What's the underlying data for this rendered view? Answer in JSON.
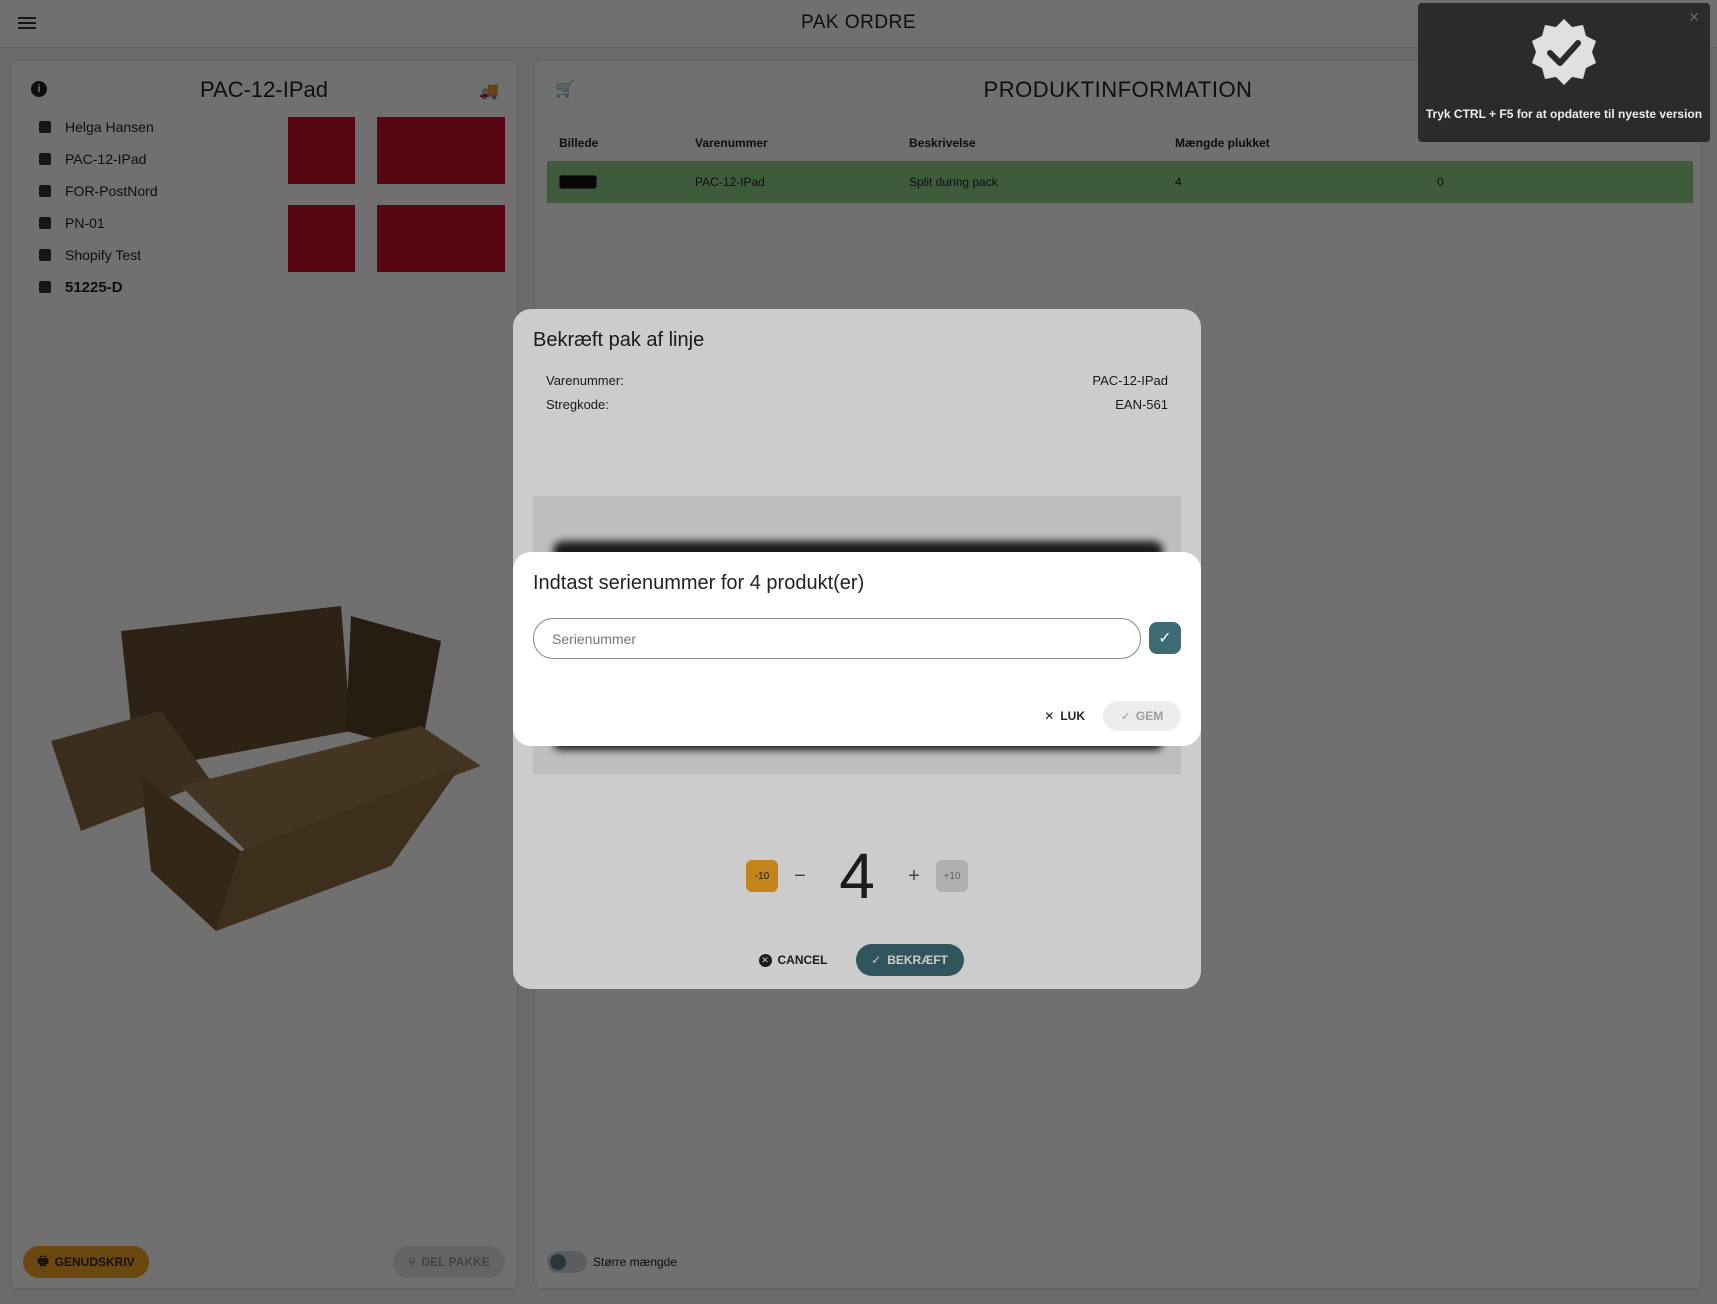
{
  "topbar": {
    "title": "PAK ORDRE"
  },
  "left_panel": {
    "title": "PAC-12-IPad",
    "info": [
      {
        "icon": "person-icon",
        "text": "Helga Hansen"
      },
      {
        "icon": "box-up-icon",
        "text": "PAC-12-IPad"
      },
      {
        "icon": "truck-icon",
        "text": "FOR-PostNord"
      },
      {
        "icon": "truck-icon",
        "text": "PN-01"
      },
      {
        "icon": "store-icon",
        "text": "Shopify Test"
      },
      {
        "icon": "save-icon",
        "text": "51225-D"
      }
    ],
    "genudskriv_label": "GENUDSKRIV",
    "delpakke_label": "DEL PAKKE"
  },
  "right_panel": {
    "title": "PRODUKTINFORMATION",
    "table": {
      "headers": [
        "Billede",
        "Varenummer",
        "Beskrivelse",
        "Mængde plukket",
        ""
      ],
      "rows": [
        {
          "varenummer": "PAC-12-IPad",
          "beskrivelse": "Split during pack",
          "plukket": "4",
          "extra": "0"
        }
      ]
    },
    "toggle_label": "Større mængde"
  },
  "confirm_dialog": {
    "title": "Bekræft pak af linje",
    "varenummer_label": "Varenummer:",
    "varenummer_value": "PAC-12-IPad",
    "stregkode_label": "Stregkode:",
    "stregkode_value": "EAN-561",
    "minus10": "-10",
    "minus": "−",
    "quantity": "4",
    "plus": "+",
    "plus10": "+10",
    "cancel_label": "CANCEL",
    "confirm_label": "BEKRÆFT"
  },
  "serial_dialog": {
    "title": "Indtast serienummer for 4 produkt(er)",
    "placeholder": "Serienummer",
    "close_label": "LUK",
    "save_label": "GEM"
  },
  "toast": {
    "message": "Tryk CTRL + F5 for at opdatere til nyeste version"
  },
  "colors": {
    "accent": "#3e6b73",
    "warning": "#f5a623",
    "row_highlight": "#8fd18a",
    "flag_red": "#c8102e"
  }
}
